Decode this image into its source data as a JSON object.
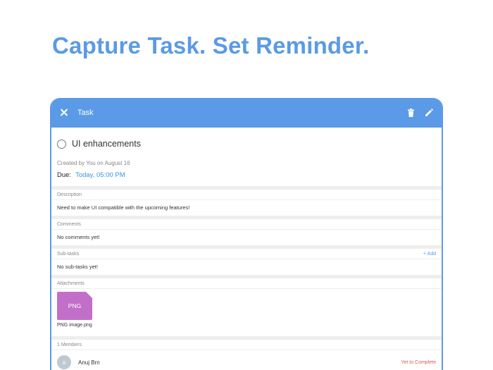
{
  "hero": {
    "title": "Capture Task. Set Reminder."
  },
  "topbar": {
    "title": "Task",
    "icons": {
      "close": "close-icon",
      "delete": "trash-icon",
      "edit": "pencil-icon"
    }
  },
  "task": {
    "name": "UI enhancements",
    "created": "Created by You on August 16",
    "due_label": "Due:",
    "due_value": "Today, 05:00 PM"
  },
  "description": {
    "label": "Description",
    "text": "Need to make UI compatible with the upcoming features!"
  },
  "comments": {
    "label": "Comments",
    "text": "No comments yet!"
  },
  "subtasks": {
    "label": "Sub-tasks",
    "add_label": "+ Add",
    "text": "No sub-tasks yet!"
  },
  "attachments": {
    "label": "Attachments",
    "file_type": "PNG",
    "file_name": "PNG image.png"
  },
  "members": {
    "label": "1 Members",
    "items": [
      {
        "initial": "A",
        "name": "Anuj Brn",
        "status": "Yet to Complete"
      }
    ]
  },
  "colors": {
    "accent": "#5b9ae6",
    "link": "#3a93e0",
    "file": "#c16fc8",
    "status_red": "#e25a4f"
  }
}
